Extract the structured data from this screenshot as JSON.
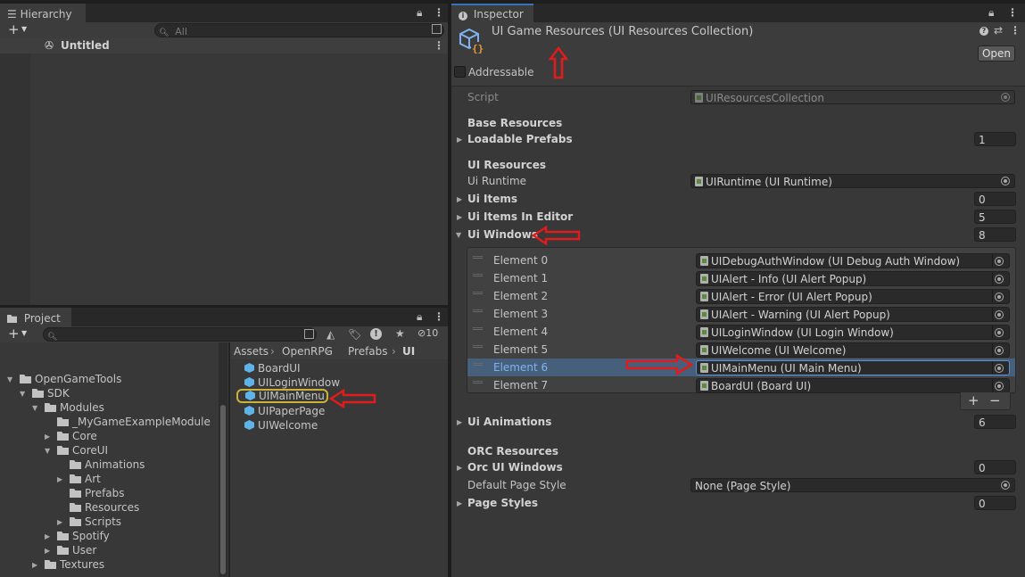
{
  "hierarchy": {
    "tab_label": "Hierarchy",
    "search_placeholder": "All",
    "scene_name": "Untitled"
  },
  "project": {
    "tab_label": "Project",
    "hidden_count": "10",
    "breadcrumb": [
      "Assets",
      "OpenRPG",
      "Prefabs",
      "UI"
    ],
    "tree": [
      {
        "label": "OpenGameTools",
        "indent": 1,
        "arrow": "down"
      },
      {
        "label": "SDK",
        "indent": 2,
        "arrow": "down"
      },
      {
        "label": "Modules",
        "indent": 3,
        "arrow": "down"
      },
      {
        "label": "_MyGameExampleModule",
        "indent": 4,
        "arrow": ""
      },
      {
        "label": "Core",
        "indent": 4,
        "arrow": "right"
      },
      {
        "label": "CoreUI",
        "indent": 4,
        "arrow": "down"
      },
      {
        "label": "Animations",
        "indent": 5,
        "arrow": ""
      },
      {
        "label": "Art",
        "indent": 5,
        "arrow": "right"
      },
      {
        "label": "Prefabs",
        "indent": 5,
        "arrow": ""
      },
      {
        "label": "Resources",
        "indent": 5,
        "arrow": ""
      },
      {
        "label": "Scripts",
        "indent": 5,
        "arrow": "right"
      },
      {
        "label": "Spotify",
        "indent": 4,
        "arrow": "right"
      },
      {
        "label": "User",
        "indent": 4,
        "arrow": "right"
      },
      {
        "label": "Textures",
        "indent": 3,
        "arrow": "right"
      }
    ],
    "assets": [
      "BoardUI",
      "UILoginWindow",
      "UIMainMenu",
      "UIPaperPage",
      "UIWelcome"
    ]
  },
  "inspector": {
    "tab_label": "Inspector",
    "title": "UI Game Resources (UI Resources Collection)",
    "open_button": "Open",
    "addressable_label": "Addressable",
    "script_label": "Script",
    "script_value": "UIResourcesCollection",
    "base_resources_header": "Base Resources",
    "loadable_prefabs_label": "Loadable Prefabs",
    "loadable_prefabs_count": "1",
    "ui_resources_header": "UI Resources",
    "ui_runtime_label": "Ui Runtime",
    "ui_runtime_value": "UIRuntime (UI Runtime)",
    "ui_items_label": "Ui Items",
    "ui_items_count": "0",
    "ui_items_editor_label": "Ui Items In Editor",
    "ui_items_editor_count": "5",
    "ui_windows_label": "Ui Windows",
    "ui_windows_count": "8",
    "elements": [
      {
        "label": "Element 0",
        "value": "UIDebugAuthWindow (UI Debug Auth Window)"
      },
      {
        "label": "Element 1",
        "value": "UIAlert - Info (UI Alert Popup)"
      },
      {
        "label": "Element 2",
        "value": "UIAlert - Error (UI Alert Popup)"
      },
      {
        "label": "Element 3",
        "value": "UIAlert - Warning (UI Alert Popup)"
      },
      {
        "label": "Element 4",
        "value": "UILoginWindow (UI Login Window)"
      },
      {
        "label": "Element 5",
        "value": "UIWelcome (UI Welcome)"
      },
      {
        "label": "Element 6",
        "value": "UIMainMenu (UI Main Menu)"
      },
      {
        "label": "Element 7",
        "value": "BoardUI (Board UI)"
      }
    ],
    "add_label": "+",
    "remove_label": "−",
    "ui_animations_label": "Ui Animations",
    "ui_animations_count": "6",
    "orc_resources_header": "ORC Resources",
    "orc_windows_label": "Orc UI Windows",
    "orc_windows_count": "0",
    "default_page_style_label": "Default Page Style",
    "default_page_style_value": "None (Page Style)",
    "page_styles_label": "Page Styles",
    "page_styles_count": "0"
  },
  "colors": {
    "accent_blue": "#7fb2f0",
    "annotation_red": "#e21b1b",
    "selected_row": "#46607c",
    "highlight_outline": "#c9b23a"
  }
}
